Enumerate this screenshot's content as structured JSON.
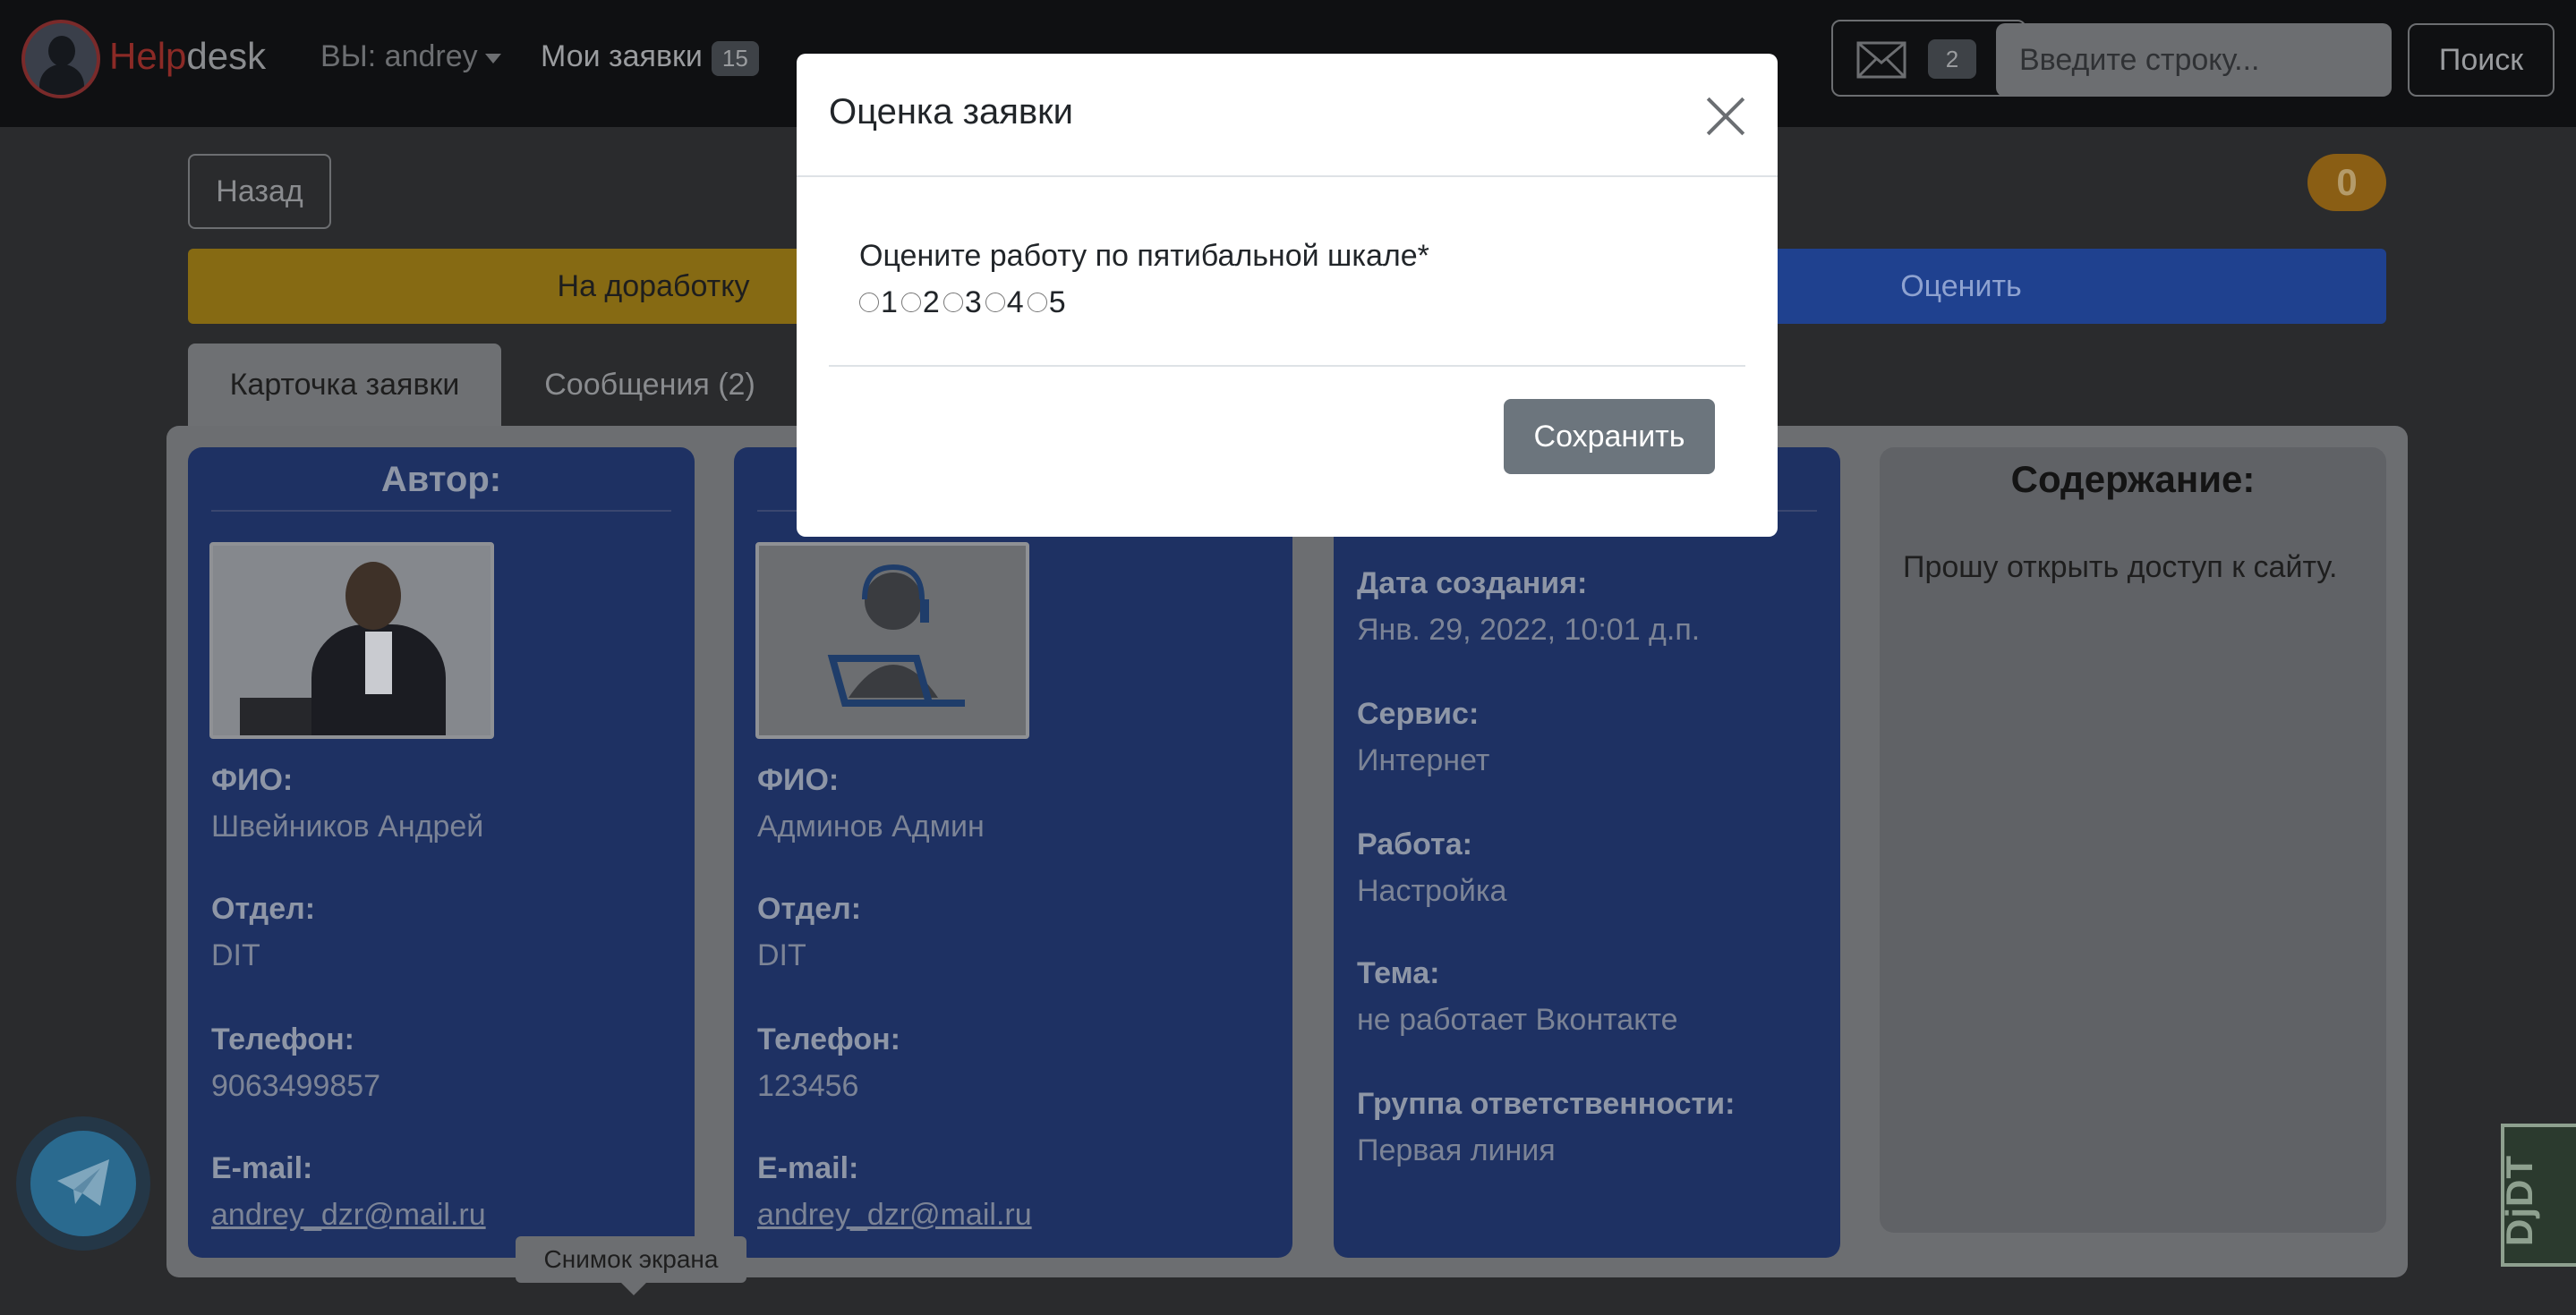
{
  "navbar": {
    "brand_help": "Help",
    "brand_desk": "desk",
    "user_label": "ВЫ: andrey",
    "my_requests": "Мои заявки",
    "my_requests_count": "15",
    "mail_count": "2",
    "search_placeholder": "Введите строку...",
    "search_button": "Поиск"
  },
  "page": {
    "back_button": "Назад",
    "counter": "0",
    "rework_button": "На доработку",
    "rate_button": "Оценить",
    "tabs": [
      {
        "label": "Карточка заявки"
      },
      {
        "label": "Сообщения (2)"
      }
    ]
  },
  "author": {
    "title": "Автор:",
    "fio_label": "ФИО:",
    "fio": "Швейников Андрей",
    "dept_label": "Отдел:",
    "dept": "DIT",
    "phone_label": "Телефон:",
    "phone": "9063499857",
    "email_label": "E-mail:",
    "email": "andrey_dzr@mail.ru"
  },
  "executor": {
    "fio_label": "ФИО:",
    "fio": "Админов Админ",
    "dept_label": "Отдел:",
    "dept": "DIT",
    "phone_label": "Телефон:",
    "phone": "123456",
    "email_label": "E-mail:",
    "email": "andrey_dzr@mail.ru"
  },
  "details": {
    "created_label": "Дата создания:",
    "created": "Янв. 29, 2022, 10:01 д.п.",
    "service_label": "Сервис:",
    "service": "Интернет",
    "work_label": "Работа:",
    "work": "Настройка",
    "topic_label": "Тема:",
    "topic": "не работает Вконтакте",
    "group_label": "Группа ответственности:",
    "group": "Первая линия"
  },
  "content": {
    "title": "Содержание:",
    "text": "Прошу открыть доступ к сайту."
  },
  "tooltip": "Снимок экрана",
  "djdt": "DjDT",
  "modal": {
    "title": "Оценка заявки",
    "question": "Оцените работу по пятибальной шкале*",
    "options": [
      "1",
      "2",
      "3",
      "4",
      "5"
    ],
    "save_button": "Сохранить"
  },
  "colors": {
    "modal_bg": "#ffffff",
    "card_blue": "#1e3163",
    "rework_yellow": "#866a13",
    "rate_blue": "#1f418f",
    "save_gray": "#6c757d"
  }
}
